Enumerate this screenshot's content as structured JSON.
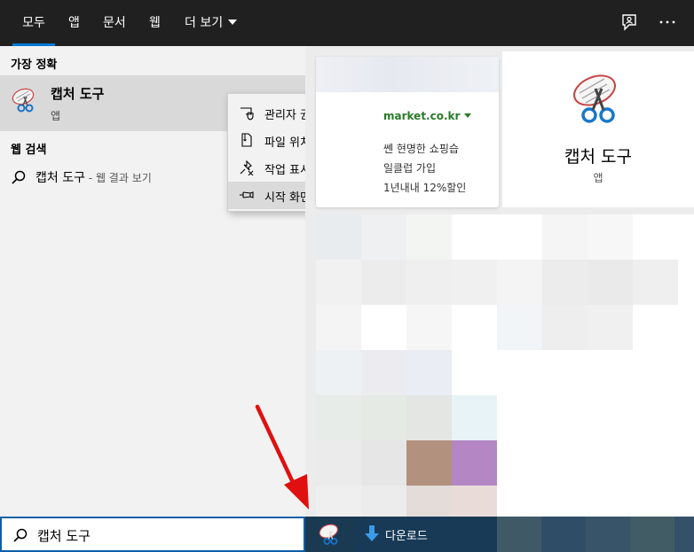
{
  "tabs": [
    {
      "label": "모두"
    },
    {
      "label": "앱"
    },
    {
      "label": "문서"
    },
    {
      "label": "웹"
    },
    {
      "label": "더 보기"
    }
  ],
  "best_match": {
    "section_title": "가장 정확",
    "name": "캡처 도구",
    "type": "앱"
  },
  "web_search": {
    "section_title": "웹 검색",
    "term": "캡처 도구",
    "suffix": " - 웹 결과 보기"
  },
  "context_menu": [
    {
      "label": "관리자 권한으로 실행",
      "icon": "shield-icon"
    },
    {
      "label": "파일 위치 열기",
      "icon": "file-icon"
    },
    {
      "label": "작업 표시줄에서 제거",
      "icon": "unpin-icon"
    },
    {
      "label": "시작 화면에 고정",
      "icon": "pin-icon"
    }
  ],
  "ad_card": {
    "domain": "market.co.kr",
    "lines": [
      "쎈 현명한 쇼핑습",
      "일클럽 가입",
      "1년내내 12%할인"
    ]
  },
  "app_card": {
    "name": "캡처 도구",
    "type": "앱"
  },
  "search": {
    "value": "캡처 도구"
  },
  "taskbar": {
    "download_label": "다운로드"
  },
  "colors": {
    "accent": "#0078d7",
    "topbar": "#202020",
    "arrow": "#e01010"
  }
}
